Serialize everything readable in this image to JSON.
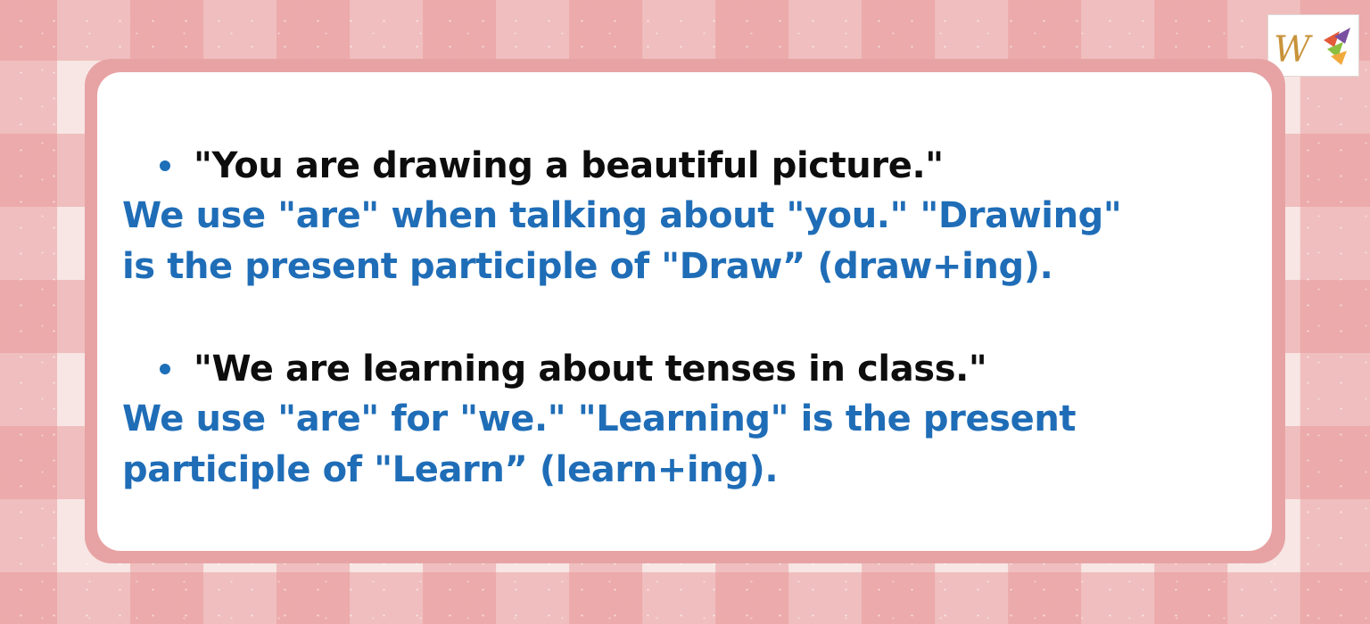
{
  "colors": {
    "background_light": "#f7e6e4",
    "background_stripe": "#e89698",
    "card_border": "#e7a3a4",
    "card_fill": "#ffffff",
    "sentence_text": "#0d0d0d",
    "explanation_text": "#1f6db7",
    "bullet": "#1c6fb8"
  },
  "logo": {
    "icon": "w-logo-with-arrows-icon",
    "letter": "W"
  },
  "examples": [
    {
      "sentence": "\"You are drawing a beautiful picture.\"",
      "explanation": "We use \"are\" when talking about \"you.\" \"Drawing\"\nis the present participle of \"Draw” (draw+ing)."
    },
    {
      "sentence": "\"We are learning about tenses in class.\"",
      "explanation": "We use \"are\" for \"we.\" \"Learning\" is the present\nparticiple of \"Learn” (learn+ing)."
    }
  ]
}
